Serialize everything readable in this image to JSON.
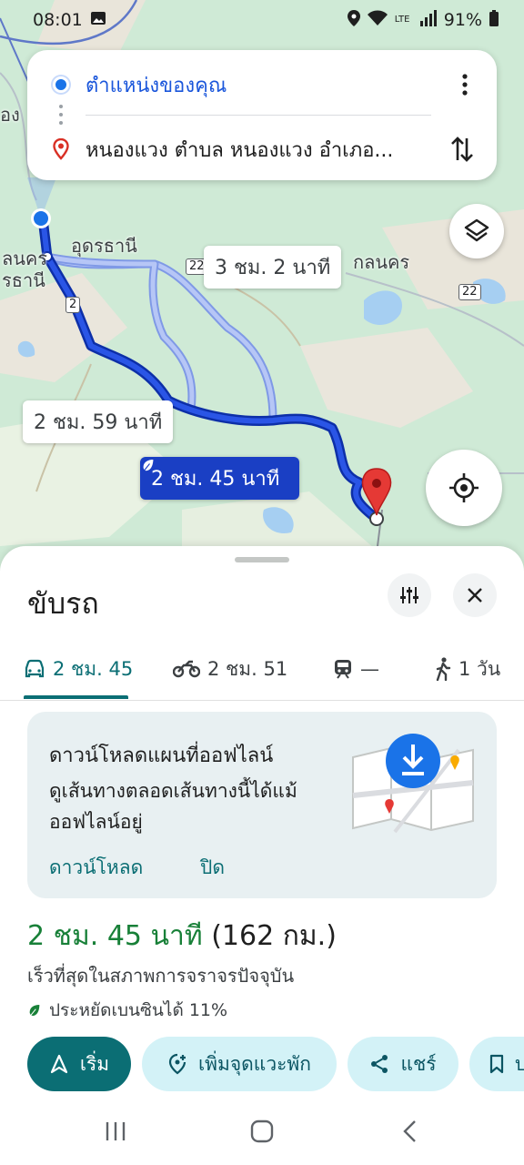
{
  "status_bar": {
    "time": "08:01",
    "battery": "91%",
    "network": "LTE"
  },
  "search": {
    "origin": "ตำแหน่งของคุณ",
    "destination": "หนองแวง ตำบล หนองแวง อำเภอ..."
  },
  "map": {
    "labels": {
      "city_udon": "อุดรธานี",
      "city_left_1": "ลนคร",
      "city_left_2": "รธานี",
      "city_right": "กลนคร",
      "top_left": "อง"
    },
    "road_shields": [
      "22",
      "2",
      "22"
    ],
    "route_times": {
      "alt_1": "3 ชม. 2 นาที",
      "alt_2": "2 ชม. 59 นาที",
      "primary": "2 ชม. 45 นาที"
    },
    "colors": {
      "primary_route": "#1a3fc4",
      "alt_route": "#9ab0f0",
      "destination_pin": "#e53935"
    }
  },
  "sheet": {
    "title": "ขับรถ",
    "modes": [
      {
        "icon": "car-icon",
        "label": "2 ชม. 45",
        "active": true
      },
      {
        "icon": "motorcycle-icon",
        "label": "2 ชม. 51",
        "active": false
      },
      {
        "icon": "train-icon",
        "label": "—",
        "active": false
      },
      {
        "icon": "walk-icon",
        "label": "1 วัน",
        "active": false
      }
    ],
    "offline": {
      "title": "ดาวน์โหลดแผนที่ออฟไลน์",
      "body": "ดูเส้นทางตลอดเส้นทางนี้ได้แม้ออฟไลน์อยู่",
      "download": "ดาวน์โหลด",
      "dismiss": "ปิด"
    },
    "eta": {
      "time": "2 ชม. 45 นาที",
      "distance": "(162 กม.)",
      "subtitle": "เร็วที่สุดในสภาพการจราจรปัจจุบัน",
      "eco": "ประหยัดเบนซินได้ 11%"
    },
    "actions": {
      "start": "เริ่ม",
      "add_stop": "เพิ่มจุดแวะพัก",
      "share": "แชร์",
      "save": "บ"
    },
    "accent": "#0b6e74"
  }
}
